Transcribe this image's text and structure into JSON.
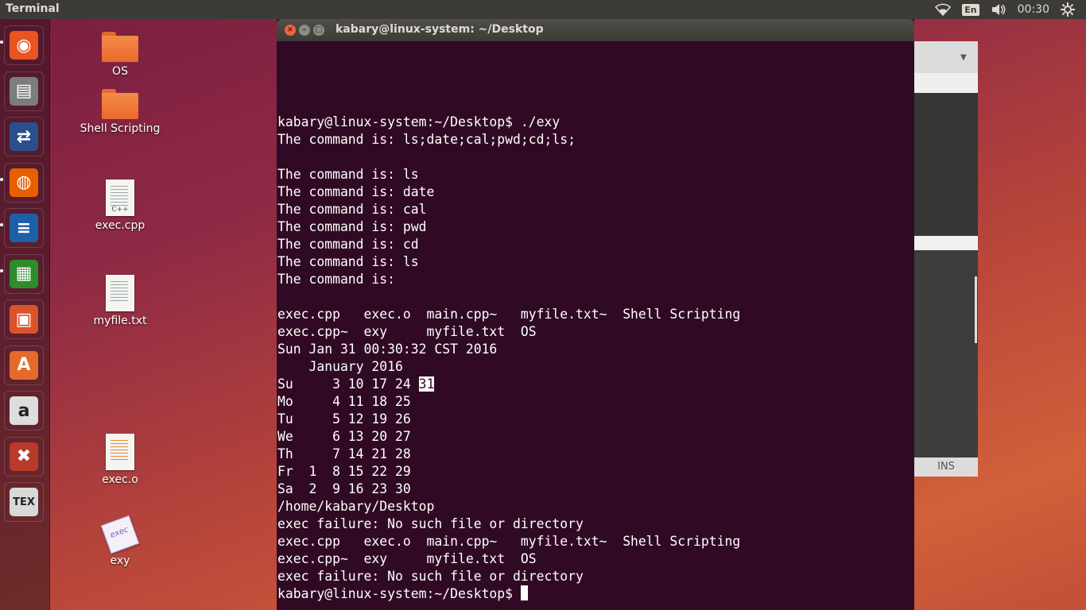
{
  "top_panel": {
    "app_title": "Terminal",
    "keyboard_layout": "En",
    "clock": "00:30",
    "icons": [
      "wifi-icon",
      "volume-icon",
      "settings-gear-icon"
    ]
  },
  "launcher": {
    "items": [
      {
        "name": "ubuntu-dash",
        "glyph": "◉",
        "color": "#e95420"
      },
      {
        "name": "files",
        "glyph": "▤",
        "color": "#7d7d7d"
      },
      {
        "name": "network-app",
        "glyph": "⇄",
        "color": "#2b4f8c"
      },
      {
        "name": "firefox",
        "glyph": "◍",
        "color": "#e66000"
      },
      {
        "name": "libreoffice-writer",
        "glyph": "≡",
        "color": "#1d5fa8"
      },
      {
        "name": "libreoffice-calc",
        "glyph": "▦",
        "color": "#2e8b2e"
      },
      {
        "name": "libreoffice-impress",
        "glyph": "▣",
        "color": "#d9542a"
      },
      {
        "name": "ubuntu-software",
        "glyph": "A",
        "color": "#e46b2b"
      },
      {
        "name": "amazon",
        "glyph": "a",
        "color": "#dddddd"
      },
      {
        "name": "system-settings",
        "glyph": "✖",
        "color": "#b73a2a"
      },
      {
        "name": "tex",
        "glyph": "TEX",
        "color": "#d8d8d8"
      }
    ]
  },
  "desktop": {
    "icons": [
      {
        "label": "OS",
        "kind": "folder"
      },
      {
        "label": "Shell Scripting",
        "kind": "folder"
      },
      {
        "label": "exec.cpp",
        "kind": "doc",
        "tag": "C++"
      },
      {
        "label": "myfile.txt",
        "kind": "doc",
        "tag": ""
      },
      {
        "label": "exec.o",
        "kind": "doc-orange",
        "tag": ""
      },
      {
        "label": "exy",
        "kind": "exe",
        "tag": "exec"
      }
    ]
  },
  "background_window": {
    "status_label": "INS"
  },
  "terminal": {
    "window_title": "kabary@linux-system: ~/Desktop",
    "lines": [
      "kabary@linux-system:~/Desktop$ ./exy",
      "The command is: ls;date;cal;pwd;cd;ls;",
      "",
      "The command is: ls",
      "The command is: date",
      "The command is: cal",
      "The command is: pwd",
      "The command is: cd",
      "The command is: ls",
      "The command is:",
      "",
      "exec.cpp   exec.o  main.cpp~   myfile.txt~  Shell Scripting",
      "exec.cpp~  exy     myfile.txt  OS",
      "Sun Jan 31 00:30:32 CST 2016",
      "    January 2016",
      "Su     3 10 17 24 31",
      "Mo     4 11 18 25",
      "Tu     5 12 19 26",
      "We     6 13 20 27",
      "Th     7 14 21 28",
      "Fr  1  8 15 22 29",
      "Sa  2  9 16 23 30",
      "/home/kabary/Desktop",
      "exec failure: No such file or directory",
      "exec.cpp   exec.o  main.cpp~   myfile.txt~  Shell Scripting",
      "exec.cpp~  exy     myfile.txt  OS",
      "exec failure: No such file or directory",
      "kabary@linux-system:~/Desktop$ "
    ],
    "highlight": {
      "line": 15,
      "text": "31"
    }
  }
}
